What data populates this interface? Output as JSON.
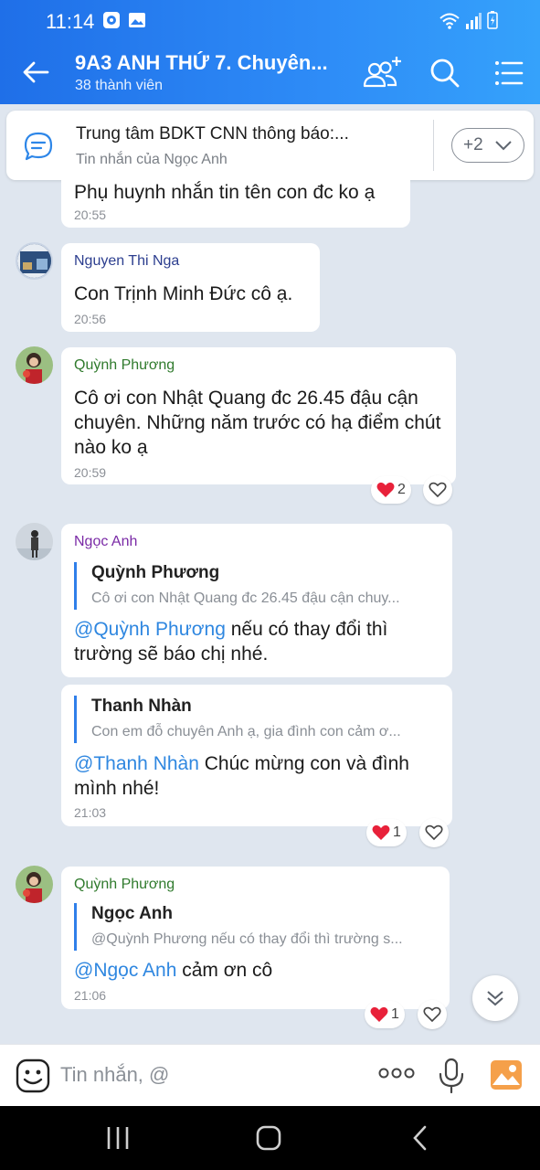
{
  "status_bar": {
    "time": "11:14"
  },
  "header": {
    "title": "9A3 ANH THỨ 7. Chuyên...",
    "member_count": "38 thành viên"
  },
  "pinned": {
    "title": "Trung tâm BDKT CNN thông báo:...",
    "subtitle": "Tin nhắn của Ngọc Anh",
    "more_count": "+2"
  },
  "messages": [
    {
      "text": "Phụ huynh nhắn tin tên con đc ko ạ",
      "time": "20:55"
    },
    {
      "sender": "Nguyen Thi Nga",
      "text": "Con Trịnh Minh Đức cô ạ.",
      "time": "20:56"
    },
    {
      "sender": "Quỳnh Phương",
      "text": "Cô ơi con Nhật Quang đc 26.45 đậu cận chuyên. Những năm trước có hạ điểm chút nào ko ạ",
      "time": "20:59",
      "reaction_count": "2"
    },
    {
      "sender": "Ngọc Anh",
      "quote_name": "Quỳnh Phương",
      "quote_text": "Cô ơi con Nhật Quang đc 26.45 đậu cận chuy...",
      "mention": "@Quỳnh Phương",
      "text": " nếu có thay đổi thì trường sẽ báo chị nhé."
    },
    {
      "quote_name": "Thanh Nhàn",
      "quote_text": "Con em đỗ chuyên Anh ạ, gia đình con cảm ơ...",
      "mention": "@Thanh Nhàn",
      "text": " Chúc mừng con và đình mình nhé!",
      "time": "21:03",
      "reaction_count": "1"
    },
    {
      "sender": "Quỳnh Phương",
      "quote_name": "Ngọc Anh",
      "quote_text": "@Quỳnh Phương nếu có thay đổi thì trường s...",
      "mention": "@Ngọc Anh",
      "text": " cảm ơn cô",
      "time": "21:06",
      "reaction_count": "1"
    }
  ],
  "composer": {
    "placeholder": "Tin nhắn, @"
  },
  "colors": {
    "header_blue": "#1f6fe8",
    "mention_blue": "#2f87e0",
    "sender_nga": "#2c3e8f",
    "sender_phuong": "#2f7a2c",
    "sender_anh": "#7a2aa6",
    "heart_red": "#e8213a"
  },
  "icons": [
    "back-arrow-icon",
    "add-member-icon",
    "search-icon",
    "menu-list-icon",
    "pinned-message-icon",
    "chevron-down-icon",
    "heart-icon",
    "like-heart-outline-icon",
    "double-chevron-down-icon",
    "emoji-icon",
    "more-dots-icon",
    "microphone-icon",
    "image-icon"
  ]
}
